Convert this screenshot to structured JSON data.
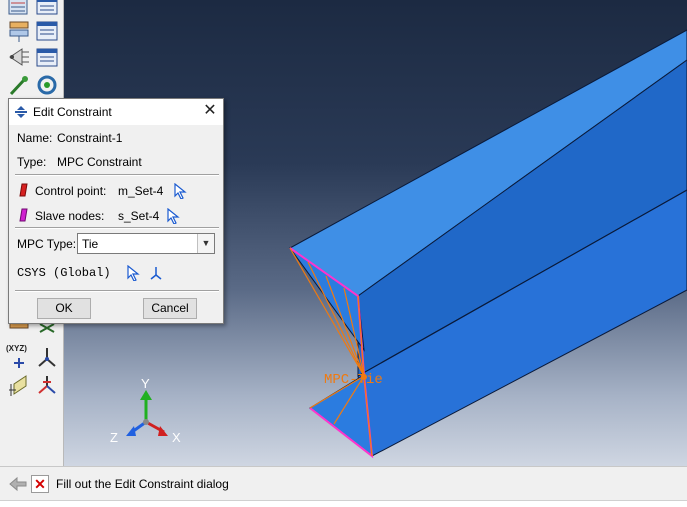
{
  "dialog": {
    "title": "Edit Constraint",
    "name_label": "Name:",
    "name_value": "Constraint-1",
    "type_label": "Type:",
    "type_value": "MPC Constraint",
    "control_point_label": "Control point:",
    "control_point_value": "m_Set-4",
    "slave_nodes_label": "Slave nodes:",
    "slave_nodes_value": "s_Set-4",
    "mpc_type_label": "MPC Type:",
    "mpc_type_value": "Tie",
    "csys_label": "CSYS  (Global)",
    "ok_label": "OK",
    "cancel_label": "Cancel"
  },
  "viewport": {
    "constraint_label": "MPC-Tie",
    "triad": {
      "y": "Y",
      "z": "Z",
      "x": "X"
    },
    "xyz_label": "(XYZ)"
  },
  "prompt": {
    "message": "Fill out the Edit Constraint dialog"
  },
  "colors": {
    "beam_top": "#3f8fe6",
    "beam_side": "#1f67c8",
    "beam_end": "#2a7ae0",
    "constraint": "#f07a10",
    "highlight": "#ff33cc"
  }
}
